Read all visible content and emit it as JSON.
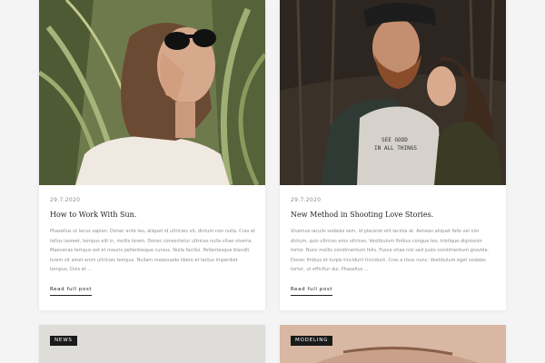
{
  "posts": [
    {
      "date": "29.7.2020",
      "title": "How to Work With Sun.",
      "excerpt": "Phasellus ut lacus sapien. Donec ante leo, aliquet id ultricies vit, dictum non nulla. Cras et tellus laoreet, tempus elit in, mollis lorem. Donec consectetur ultrices nulla vitae viverra. Maecenas tempus est et mauris pellentesque cursus. Nulla facilisi. Pellentesque blandit lorem sit amet enim ultricies tempus. Nullam malesuada libero et lectus imperdiet tempus. Duis et ...",
      "read_label": "Read full post"
    },
    {
      "date": "29.7.2020",
      "title": "New Method in Shooting Love Stories.",
      "excerpt": "Vivamus iaculis sodales sem, id placerat elit lacinia at. Aenean aliquet felis vel nisi dictum, quis ultrices eros ultrices. Vestibulum finibus congue leo, tristique dignissim tortor. Nunc mollis condimentum felis. Fusce vitae nisl sed justo condimentum gravida. Donec finibus et turpis tincidunt tincidunt. Cras a risus nunc. Vestibulum eget sodales tortor, ut efficitur dui. Phasellus ...",
      "read_label": "Read full post",
      "shirt_text": "SEE GOOD\nIN ALL THINGS"
    }
  ],
  "next_posts": [
    {
      "tag": "NEWS"
    },
    {
      "tag": "MODELING"
    }
  ]
}
